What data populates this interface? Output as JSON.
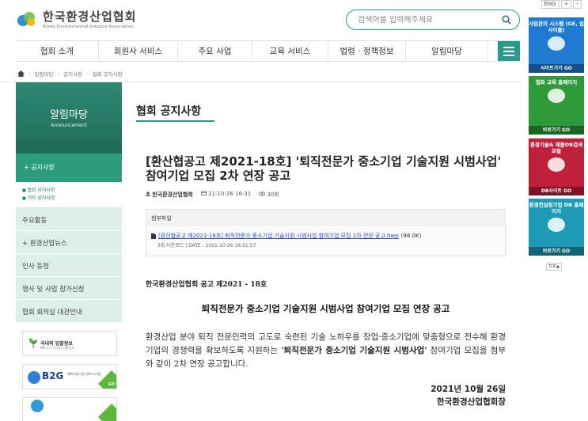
{
  "header": {
    "logo_ko": "한국환경산업협회",
    "logo_en": "Korea Environmental Industry Association",
    "search_placeholder": "검색어를 입력해주세요",
    "util": [
      "ENG",
      "+",
      "-"
    ]
  },
  "nav": [
    "협회 소개",
    "회원사 서비스",
    "주요 사업",
    "교육 서비스",
    "법령 · 정책정보",
    "알림마당"
  ],
  "breadcrumb": [
    "알림마당",
    "공지사항",
    "협회 공지사항"
  ],
  "sidebar": {
    "title": "알림마당",
    "subtitle": "Announcement",
    "active": "+ 공지사항",
    "sub_items": [
      "협회 공지사항",
      "기타 공지사항"
    ],
    "items": [
      "주요활동",
      "+ 환경산업뉴스",
      "인사 동정",
      "행사 및 사업 참가신청",
      "협회 회의실 대관안내"
    ],
    "banner1_title": "국내외 입찰정보",
    "banner1_sub": "빠른소식 국내외 입찰정보",
    "banner2_title": "B2G",
    "banner2_sub": "해외조달시장 정보시스템",
    "go": "GO"
  },
  "main": {
    "page_title": "협회 공지사항",
    "post_title": "[환산협공고 제2021-18호] '퇴직전문가 중소기업 기술지원 시범사업' 참여기업 모집 2차 연장 공고",
    "author": "한국환경산업협회",
    "date": "21-10-26 16:31",
    "views": "30회",
    "attach_label": "첨부파일",
    "file_name": "[환산협공고 제2021-18호] 퇴직전문가 중소기업 기술지원 시범사업 참여기업 모집 2차 연장 공고.hwp",
    "file_size": "(98.0K)",
    "download_info": "3회 다운로드 | DATE : 2021-10-26 16:31:57",
    "body_org": "한국환경산업협회 공고 제2021 - 18호",
    "body_head": "퇴직전문가 중소기업 기술지원 시범사업 참여기업 모집 연장 공고",
    "para_1": "환경산업 분야 퇴직 전문인력의 고도로 숙련된 기술 노하우를 창업·중소기업에 맞춤형으로 전수해 환경기업의 경쟁력을 확보하도록 지원하는 ",
    "para_bold": "'퇴직전문가 중소기업 기술지원 시범사업'",
    "para_2": " 참여기업 모집을 첨부와 같이 2차 연장 공고합니다.",
    "body_date": "2021년 10월 26일",
    "body_sign": "한국환경산업협회장"
  },
  "quick": [
    {
      "title": "사업관리 시스템 (GE, 업사이클)",
      "go": "사이트가기 GO"
    },
    {
      "title": "협회 교육 홈페이지",
      "go": "바로가기 GO"
    },
    {
      "title": "환경기술& 제품DB검색포털",
      "go": "DB사이트 GO"
    },
    {
      "title": "환경컨설팅기업 DB 홈페이지",
      "go": "바로가기 GO"
    }
  ],
  "top_label": "TOP▲"
}
